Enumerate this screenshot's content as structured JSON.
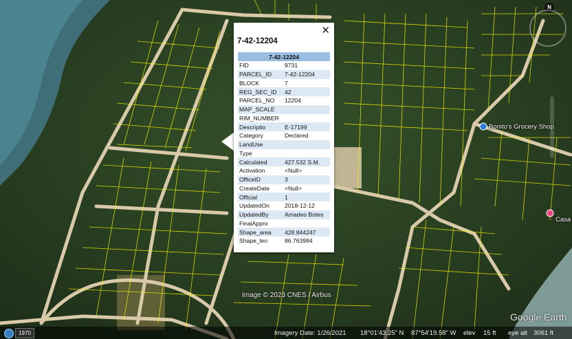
{
  "popup": {
    "title": "7-42-12204",
    "header": "7-42-12204",
    "close_glyph": "✕",
    "rows": [
      {
        "key": "FID",
        "value": "9731"
      },
      {
        "key": "PARCEL_ID",
        "value": "7-42-12204"
      },
      {
        "key": "BLOCK",
        "value": "7"
      },
      {
        "key": "REG_SEC_ID",
        "value": "42"
      },
      {
        "key": "PARCEL_NO",
        "value": "12204"
      },
      {
        "key": "MAP_SCALE",
        "value": ""
      },
      {
        "key": "RIM_NUMBER",
        "value": ""
      },
      {
        "key": "Descriptio",
        "value": "E-17199"
      },
      {
        "key": "Category",
        "value": "Declared"
      },
      {
        "key": "LandUse",
        "value": ""
      },
      {
        "key": "Type",
        "value": ""
      },
      {
        "key": "Calculated",
        "value": "427.532 S.M."
      },
      {
        "key": "Activation",
        "value": "<Null>"
      },
      {
        "key": "OfficeID",
        "value": "3"
      },
      {
        "key": "CreateDate",
        "value": "<Null>"
      },
      {
        "key": "Official",
        "value": "1"
      },
      {
        "key": "UpdatedOn",
        "value": "2018-12-12"
      },
      {
        "key": "UpdatedBy",
        "value": "Amadeo Botes"
      },
      {
        "key": "FinalAppro",
        "value": ""
      },
      {
        "key": "Shape_area",
        "value": "428.844247"
      },
      {
        "key": "Shape_len",
        "value": "86.763984"
      }
    ]
  },
  "places": {
    "grocery": "Bonito's Grocery Shop",
    "casa": "Casa"
  },
  "map": {
    "credit": "Image © 2023 CNES / Airbus",
    "logo": "Google Earth",
    "compass": "N",
    "colors": {
      "parcel_lines": "#f2f200",
      "road": "#d8c9a8",
      "vegetation": "#2f4a25"
    }
  },
  "status": {
    "year": "1970",
    "imagery_date": "Imagery Date: 1/26/2021",
    "latitude": "18°01'43.25\" N",
    "longitude": "87°54'19.58\" W",
    "elev_label": "elev",
    "elev_value": "15 ft",
    "eye_alt_label": "eye alt",
    "eye_alt_value": "3061 ft"
  },
  "icons": [
    "globe-icon",
    "close-icon",
    "compass-icon",
    "shop-pin-icon",
    "place-pin-icon"
  ]
}
